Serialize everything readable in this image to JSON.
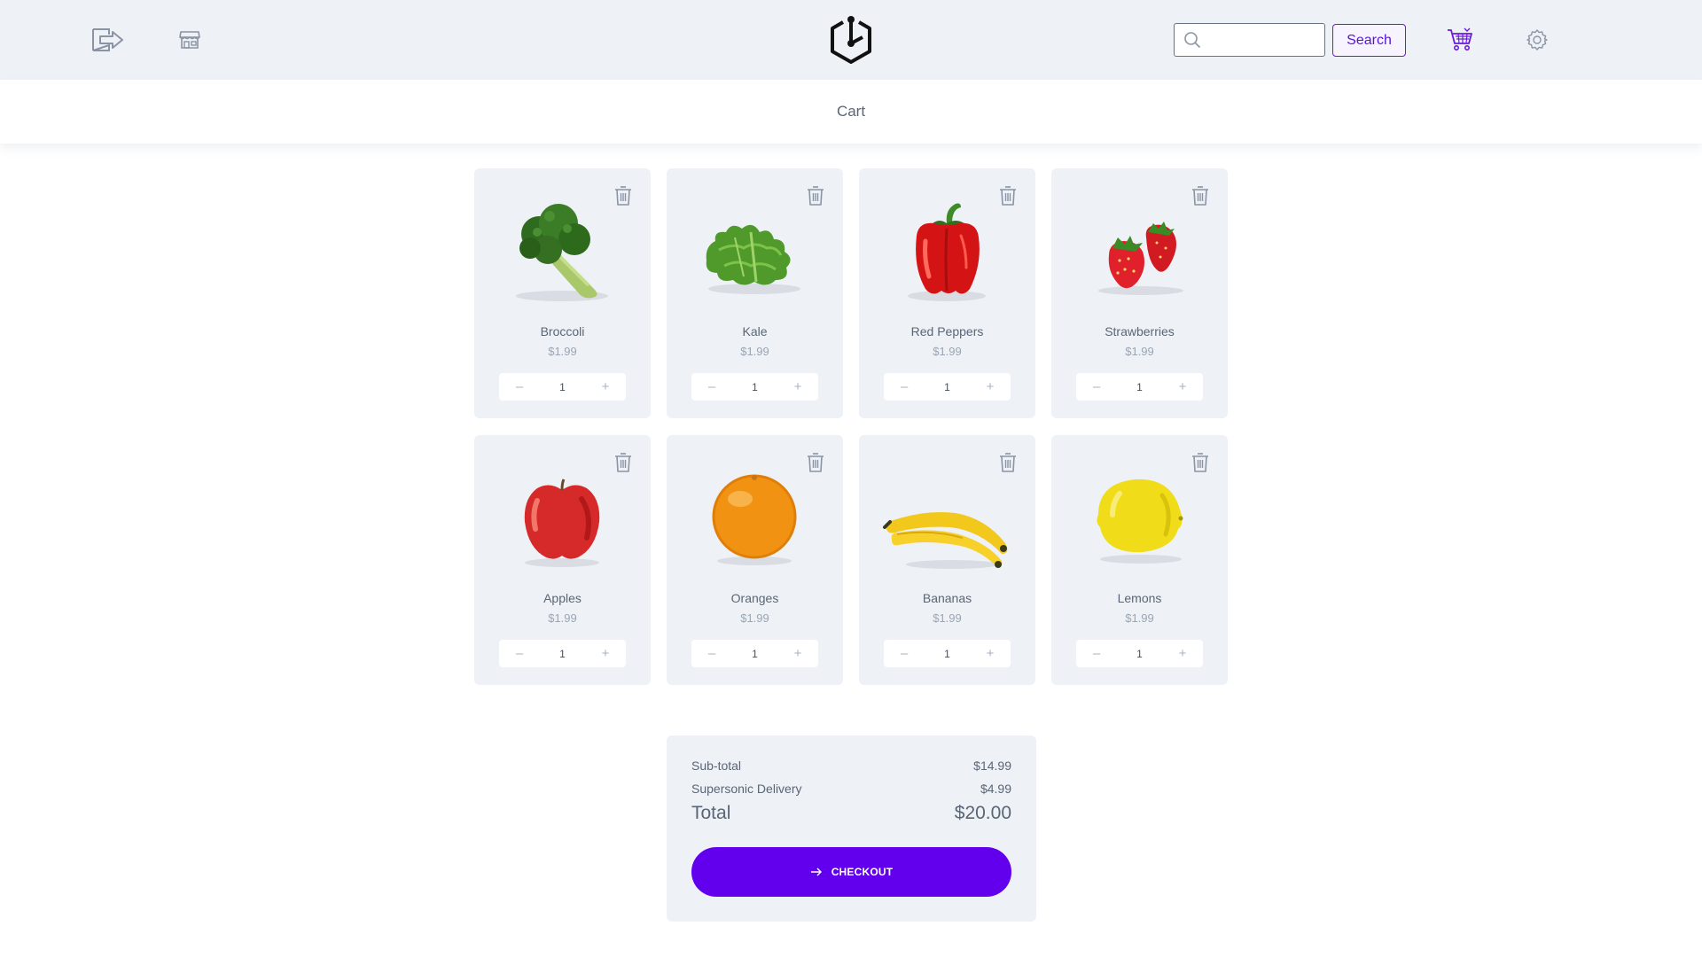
{
  "header": {
    "icons": {
      "logout": "logout-icon",
      "store": "store-icon",
      "logo": "hexagon-logo-icon",
      "search": "search-icon",
      "cart": "cart-icon",
      "settings": "gear-icon"
    },
    "search": {
      "value": "",
      "placeholder": ""
    },
    "search_button_label": "Search"
  },
  "page": {
    "title": "Cart"
  },
  "products": [
    {
      "name": "Broccoli",
      "price": "$1.99",
      "quantity": "1",
      "image": "broccoli"
    },
    {
      "name": "Kale",
      "price": "$1.99",
      "quantity": "1",
      "image": "kale"
    },
    {
      "name": "Red Peppers",
      "price": "$1.99",
      "quantity": "1",
      "image": "red-pepper"
    },
    {
      "name": "Strawberries",
      "price": "$1.99",
      "quantity": "1",
      "image": "strawberries"
    },
    {
      "name": "Apples",
      "price": "$1.99",
      "quantity": "1",
      "image": "apple"
    },
    {
      "name": "Oranges",
      "price": "$1.99",
      "quantity": "1",
      "image": "orange"
    },
    {
      "name": "Bananas",
      "price": "$1.99",
      "quantity": "1",
      "image": "bananas"
    },
    {
      "name": "Lemons",
      "price": "$1.99",
      "quantity": "1",
      "image": "lemon"
    }
  ],
  "stepper": {
    "decrement": "–",
    "increment": "+"
  },
  "summary": {
    "subtotal_label": "Sub-total",
    "subtotal_value": "$14.99",
    "delivery_label": "Supersonic Delivery",
    "delivery_value": "$4.99",
    "total_label": "Total",
    "total_value": "$20.00",
    "checkout_label": "CHECKOUT"
  },
  "colors": {
    "accent": "#6200ee",
    "header_bg": "#eef1f6",
    "card_bg": "#eef1f6",
    "text": "#5a6675",
    "muted_text": "#9aa6b4"
  }
}
